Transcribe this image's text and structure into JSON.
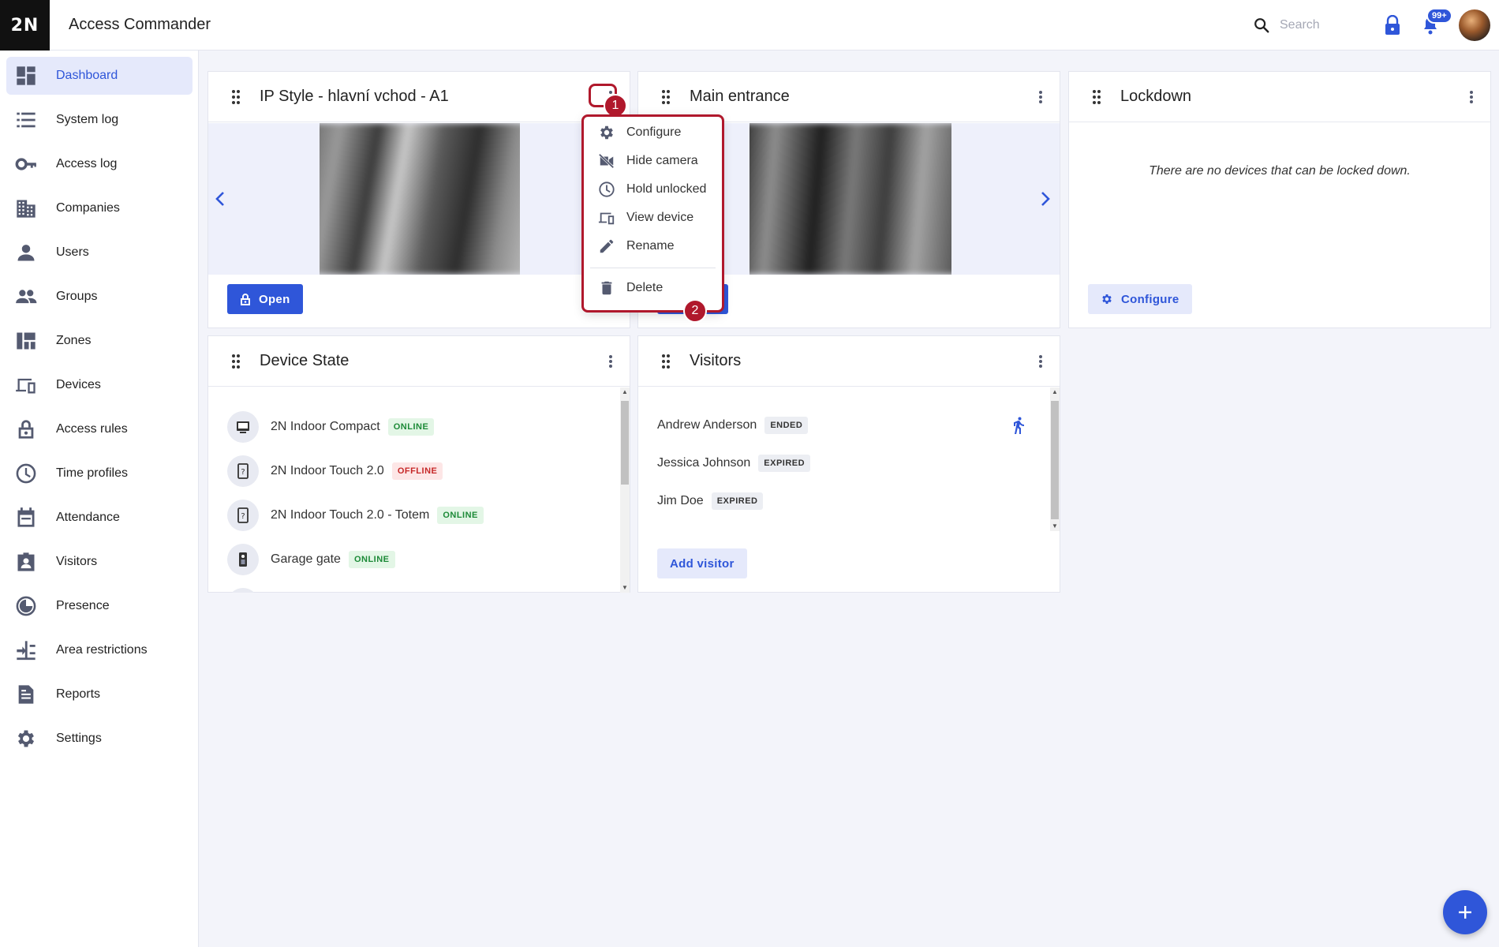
{
  "app": {
    "logo": "2N",
    "title": "Access Commander"
  },
  "header": {
    "search_placeholder": "Search",
    "notification_count": "99+"
  },
  "sidebar": {
    "items": [
      {
        "label": "Dashboard",
        "icon": "dashboard-icon",
        "active": true
      },
      {
        "label": "System log",
        "icon": "list-icon"
      },
      {
        "label": "Access log",
        "icon": "key-icon"
      },
      {
        "label": "Companies",
        "icon": "building-icon"
      },
      {
        "label": "Users",
        "icon": "user-icon"
      },
      {
        "label": "Groups",
        "icon": "group-icon"
      },
      {
        "label": "Zones",
        "icon": "zones-icon"
      },
      {
        "label": "Devices",
        "icon": "devices-icon"
      },
      {
        "label": "Access rules",
        "icon": "lock-icon"
      },
      {
        "label": "Time profiles",
        "icon": "clock-icon"
      },
      {
        "label": "Attendance",
        "icon": "calendar-icon"
      },
      {
        "label": "Visitors",
        "icon": "visitor-badge-icon"
      },
      {
        "label": "Presence",
        "icon": "presence-icon"
      },
      {
        "label": "Area restrictions",
        "icon": "area-restrictions-icon"
      },
      {
        "label": "Reports",
        "icon": "report-icon"
      },
      {
        "label": "Settings",
        "icon": "gear-icon"
      }
    ]
  },
  "cards": {
    "camera1": {
      "title": "IP Style - hlavní vchod - A1",
      "open_label": "Open"
    },
    "camera2": {
      "title": "Main entrance"
    },
    "lockdown": {
      "title": "Lockdown",
      "empty_message": "There are no devices that can be locked down.",
      "configure_label": "Configure"
    },
    "device_state": {
      "title": "Device State",
      "devices": [
        {
          "name": "2N Indoor Compact",
          "status": "ONLINE",
          "icon": "indoor-compact-icon"
        },
        {
          "name": "2N Indoor Touch 2.0",
          "status": "OFFLINE",
          "icon": "indoor-touch-icon"
        },
        {
          "name": "2N Indoor Touch 2.0 - Totem",
          "status": "ONLINE",
          "icon": "indoor-touch-icon"
        },
        {
          "name": "Garage gate",
          "status": "ONLINE",
          "icon": "intercom-icon"
        }
      ]
    },
    "visitors": {
      "title": "Visitors",
      "items": [
        {
          "name": "Andrew Anderson",
          "status": "ENDED"
        },
        {
          "name": "Jessica Johnson",
          "status": "EXPIRED"
        },
        {
          "name": "Jim Doe",
          "status": "EXPIRED"
        }
      ],
      "add_label": "Add visitor"
    }
  },
  "context_menu": {
    "items": [
      {
        "label": "Configure",
        "icon": "gear-icon"
      },
      {
        "label": "Hide camera",
        "icon": "camera-off-icon"
      },
      {
        "label": "Hold unlocked",
        "icon": "clock-icon"
      },
      {
        "label": "View device",
        "icon": "devices-icon"
      },
      {
        "label": "Rename",
        "icon": "pencil-icon"
      },
      {
        "label": "Delete",
        "icon": "trash-icon"
      }
    ]
  },
  "annotations": {
    "step1": "1",
    "step2": "2"
  },
  "colors": {
    "accent": "#2f56d9",
    "highlight": "#b0182c",
    "online": "#1c8a37",
    "offline": "#c62828"
  }
}
